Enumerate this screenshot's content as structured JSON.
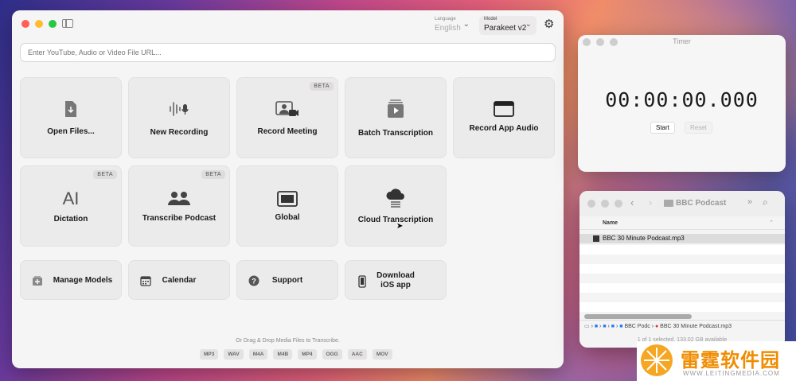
{
  "main": {
    "language": {
      "caption": "Language",
      "value": "English"
    },
    "model": {
      "caption": "Model",
      "value": "Parakeet v2"
    },
    "url_placeholder": "Enter YouTube, Audio or Video File URL...",
    "tiles": {
      "open_files": "Open Files...",
      "new_recording": "New Recording",
      "record_meeting": "Record Meeting",
      "batch_transcription": "Batch Transcription",
      "record_app_audio": "Record App Audio",
      "dictation": "Dictation",
      "transcribe_podcast": "Transcribe Podcast",
      "global": "Global",
      "cloud_transcription": "Cloud Transcription",
      "manage_models": "Manage Models",
      "calendar": "Calendar",
      "support": "Support",
      "download_ios_line1": "Download",
      "download_ios_line2": "iOS app"
    },
    "beta": "BETA",
    "drop_hint": "Or Drag & Drop Media Files to Transcribe.",
    "formats": [
      "MP3",
      "WAV",
      "M4A",
      "M4B",
      "MP4",
      "OGG",
      "AAC",
      "MOV"
    ]
  },
  "timer": {
    "title": "Timer",
    "time": "00:00:00.000",
    "start": "Start",
    "reset": "Reset"
  },
  "finder": {
    "title": "BBC Podcast",
    "column_name": "Name",
    "file": "BBC 30 Minute Podcast.mp3",
    "path_folder": "BBC Podc",
    "path_file": "BBC 30 Minute Podcast.mp3",
    "status": "1 of 1 selected, 133.02 GB available"
  },
  "watermark": {
    "cn": "雷霆软件园",
    "url": "WWW.LEITINGMEDIA.COM"
  },
  "colors": {
    "close": "#fe5f57",
    "minimize": "#febc2e",
    "zoom": "#28c840",
    "inactive": "#cfcdcd",
    "accent": "#1f7cf3"
  }
}
